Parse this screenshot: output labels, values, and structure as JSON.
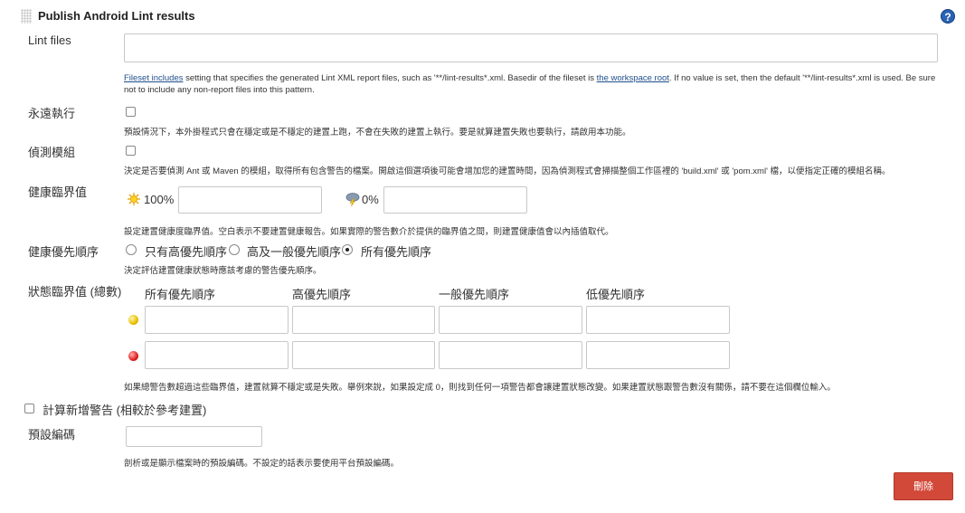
{
  "section": {
    "title": "Publish Android Lint results",
    "help_icon": "help-icon",
    "help_glyph": "?"
  },
  "lint_files": {
    "label": "Lint files",
    "value": "",
    "desc_link1": "Fileset includes",
    "desc_part1": " setting that specifies the generated Lint XML report files, such as '**/lint-results*.xml. Basedir of the fileset is ",
    "desc_link2": "the workspace root",
    "desc_part2": ". If no value is set, then the default '**/lint-results*.xml is used. Be sure not to include any non-report files into this pattern."
  },
  "always_run": {
    "label": "永遠執行",
    "checked": false,
    "desc": "預設情況下，本外掛程式只會在穩定或是不穩定的建置上跑，不會在失敗的建置上執行。要是就算建置失敗也要執行，請啟用本功能。"
  },
  "detect_modules": {
    "label": "偵測模組",
    "checked": false,
    "desc": "決定是否要偵測 Ant 或 Maven 的模組，取得所有包含警告的檔案。開啟這個選項後可能會增加您的建置時間，因為偵測程式會掃描整個工作區裡的 'build.xml' 或 'pom.xml' 檔，以便指定正確的模組名稱。"
  },
  "health": {
    "label": "健康臨界值",
    "healthy_label": "100%",
    "unhealthy_label": "0%",
    "healthy_value": "",
    "unhealthy_value": "",
    "desc": "設定建置健康度臨界值。空白表示不要建置健康報告。如果實際的警告數介於提供的臨界值之間，則建置健康值會以內插值取代。"
  },
  "priority": {
    "label": "健康優先順序",
    "options": [
      "只有高優先順序",
      "高及一般優先順序",
      "所有優先順序"
    ],
    "selected": 2,
    "desc": "決定評估建置健康狀態時應該考慮的警告優先順序。"
  },
  "status": {
    "label": "狀態臨界值 (總數)",
    "columns": [
      "所有優先順序",
      "高優先順序",
      "一般優先順序",
      "低優先順序"
    ],
    "desc": "如果總警告數超過這些臨界值，建置就算不穩定或是失敗。舉例來說，如果設定成 0，則找到任何一項警告都會讓建置狀態改變。如果建置狀態跟警告數沒有關係，請不要在這個欄位輸入。"
  },
  "new_warnings": {
    "label": "計算新增警告 (相較於參考建置)",
    "checked": false
  },
  "encoding": {
    "label": "預設編碼",
    "value": "",
    "desc": "剖析或是顯示檔案時的預設編碼。不設定的話表示要使用平台預設編碼。"
  },
  "delete_button": {
    "label": "刪除",
    "color": "#d24939"
  }
}
